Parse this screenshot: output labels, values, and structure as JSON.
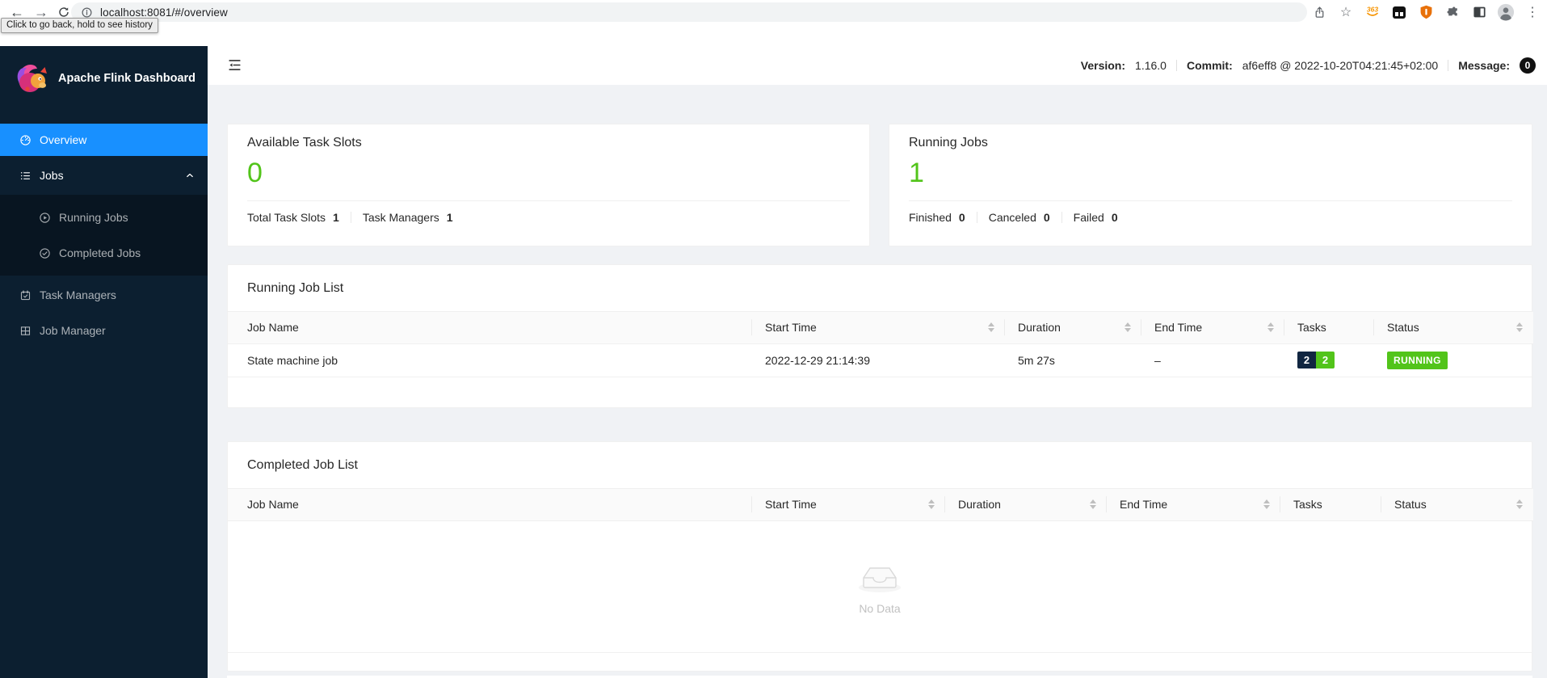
{
  "browser": {
    "url": "localhost:8081/#/overview",
    "tooltip": "Click to go back, hold to see history",
    "extension_badge": "363"
  },
  "sidebar": {
    "title": "Apache Flink Dashboard",
    "items": {
      "overview": "Overview",
      "jobs": "Jobs",
      "running_jobs": "Running Jobs",
      "completed_jobs": "Completed Jobs",
      "task_managers": "Task Managers",
      "job_manager": "Job Manager"
    }
  },
  "header": {
    "version_label": "Version:",
    "version": "1.16.0",
    "commit_label": "Commit:",
    "commit": "af6eff8 @ 2022-10-20T04:21:45+02:00",
    "message_label": "Message:",
    "message_count": "0"
  },
  "stats": {
    "available_task_slots": {
      "title": "Available Task Slots",
      "value": "0",
      "footer": [
        {
          "label": "Total Task Slots",
          "value": "1"
        },
        {
          "label": "Task Managers",
          "value": "1"
        }
      ]
    },
    "running_jobs": {
      "title": "Running Jobs",
      "value": "1",
      "footer": [
        {
          "label": "Finished",
          "value": "0"
        },
        {
          "label": "Canceled",
          "value": "0"
        },
        {
          "label": "Failed",
          "value": "0"
        }
      ]
    }
  },
  "running_job_list": {
    "title": "Running Job List",
    "columns": [
      "Job Name",
      "Start Time",
      "Duration",
      "End Time",
      "Tasks",
      "Status"
    ],
    "rows": [
      {
        "job_name": "State machine job",
        "start_time": "2022-12-29 21:14:39",
        "duration": "5m 27s",
        "end_time": "–",
        "tasks_total": "2",
        "tasks_running": "2",
        "status": "RUNNING"
      }
    ]
  },
  "completed_job_list": {
    "title": "Completed Job List",
    "columns": [
      "Job Name",
      "Start Time",
      "Duration",
      "End Time",
      "Tasks",
      "Status"
    ],
    "empty_text": "No Data"
  },
  "colors": {
    "accent_blue": "#1890ff",
    "success_green": "#52c41a",
    "sidebar_bg": "#0c1f30",
    "submenu_bg": "#081521",
    "task_total_badge_bg": "#112641",
    "task_running_badge_bg": "#52c41a",
    "status_running_bg": "#52c41a",
    "message_badge_bg": "#111111"
  }
}
